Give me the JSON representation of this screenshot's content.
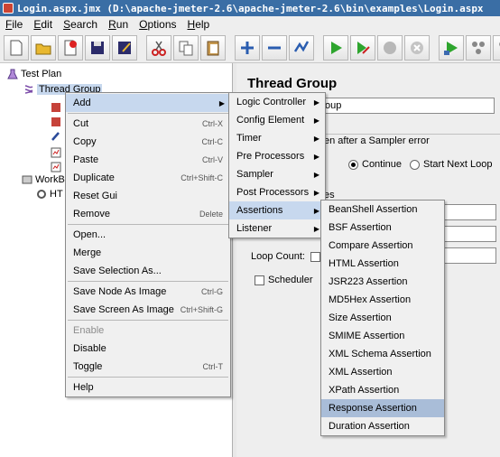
{
  "window": {
    "title": "Login.aspx.jmx (D:\\apache-jmeter-2.6\\apache-jmeter-2.6\\bin\\examples\\Login.aspx"
  },
  "menubar": [
    "File",
    "Edit",
    "Search",
    "Run",
    "Options",
    "Help"
  ],
  "toolbar": [
    "new-icon",
    "open-icon",
    "close-icon",
    "save-icon",
    "save-as-icon",
    "cut-icon",
    "copy-icon",
    "paste-icon",
    "expand-icon",
    "collapse-icon",
    "toggle-icon",
    "start-icon",
    "start-no-pause-icon",
    "stop-icon",
    "shutdown-icon",
    "remote-start-icon",
    "remote-start-all-icon",
    "remote-stop-icon"
  ],
  "tree": {
    "test_plan": "Test Plan",
    "thread_group": "Thread Group",
    "workbench": "WorkBe",
    "http_fragment": "HT"
  },
  "panel": {
    "title": "Thread Group",
    "name_value": "oup",
    "error_fragment": "en after a Sampler error",
    "continue_label": "Continue",
    "next_loop_label": "Start Next Loop",
    "props_fragment": "es",
    "loop_count_label": "Loop Count:",
    "scheduler_label": "Scheduler"
  },
  "context_menu": [
    {
      "label": "Add",
      "accel": "",
      "submenu": true
    },
    {
      "separator": true
    },
    {
      "label": "Cut",
      "accel": "Ctrl-X"
    },
    {
      "label": "Copy",
      "accel": "Ctrl-C"
    },
    {
      "label": "Paste",
      "accel": "Ctrl-V"
    },
    {
      "label": "Duplicate",
      "accel": "Ctrl+Shift-C"
    },
    {
      "label": "Reset Gui",
      "accel": ""
    },
    {
      "label": "Remove",
      "accel": "Delete"
    },
    {
      "separator": true
    },
    {
      "label": "Open...",
      "accel": ""
    },
    {
      "label": "Merge",
      "accel": ""
    },
    {
      "label": "Save Selection As...",
      "accel": ""
    },
    {
      "separator": true
    },
    {
      "label": "Save Node As Image",
      "accel": "Ctrl-G"
    },
    {
      "label": "Save Screen As Image",
      "accel": "Ctrl+Shift-G"
    },
    {
      "separator": true
    },
    {
      "label": "Enable",
      "accel": "",
      "disabled": true
    },
    {
      "label": "Disable",
      "accel": ""
    },
    {
      "label": "Toggle",
      "accel": "Ctrl-T"
    },
    {
      "separator": true
    },
    {
      "label": "Help",
      "accel": ""
    }
  ],
  "add_menu": [
    "Logic Controller",
    "Config Element",
    "Timer",
    "Pre Processors",
    "Sampler",
    "Post Processors",
    "Assertions",
    "Listener"
  ],
  "assertions_menu": [
    "BeanShell Assertion",
    "BSF Assertion",
    "Compare Assertion",
    "HTML Assertion",
    "JSR223 Assertion",
    "MD5Hex Assertion",
    "Size Assertion",
    "SMIME Assertion",
    "XML Schema Assertion",
    "XML Assertion",
    "XPath Assertion",
    "Response Assertion",
    "Duration Assertion"
  ]
}
